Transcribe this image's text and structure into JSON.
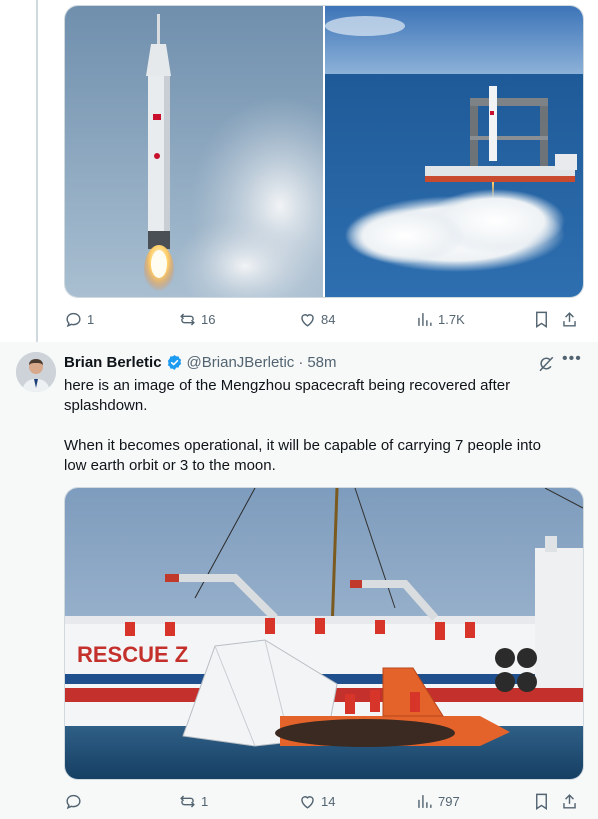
{
  "first_tweet": {
    "media_alt": "Rocket launch and sea platform launch photos",
    "actions": {
      "replies": "1",
      "reposts": "16",
      "likes": "84",
      "views": "1.7K"
    }
  },
  "second_tweet": {
    "author": {
      "name": "Brian Berletic",
      "handle": "@BrianJBerletic",
      "separator": "·",
      "time": "58m",
      "verified": true
    },
    "text": "here is an image of the Mengzhou spacecraft being recovered after splashdown.\n\nWhen it becomes operational, it will be capable of carrying 7 people into low earth orbit or 3 to the moon.",
    "media": {
      "ship_label": "RESCUE Z"
    },
    "actions": {
      "replies": "",
      "reposts": "1",
      "likes": "14",
      "views": "797"
    }
  },
  "colors": {
    "accent": "#1d9bf0",
    "muted": "#536471",
    "border": "#cfd9de",
    "highlight_bg": "#f7f9f9"
  }
}
